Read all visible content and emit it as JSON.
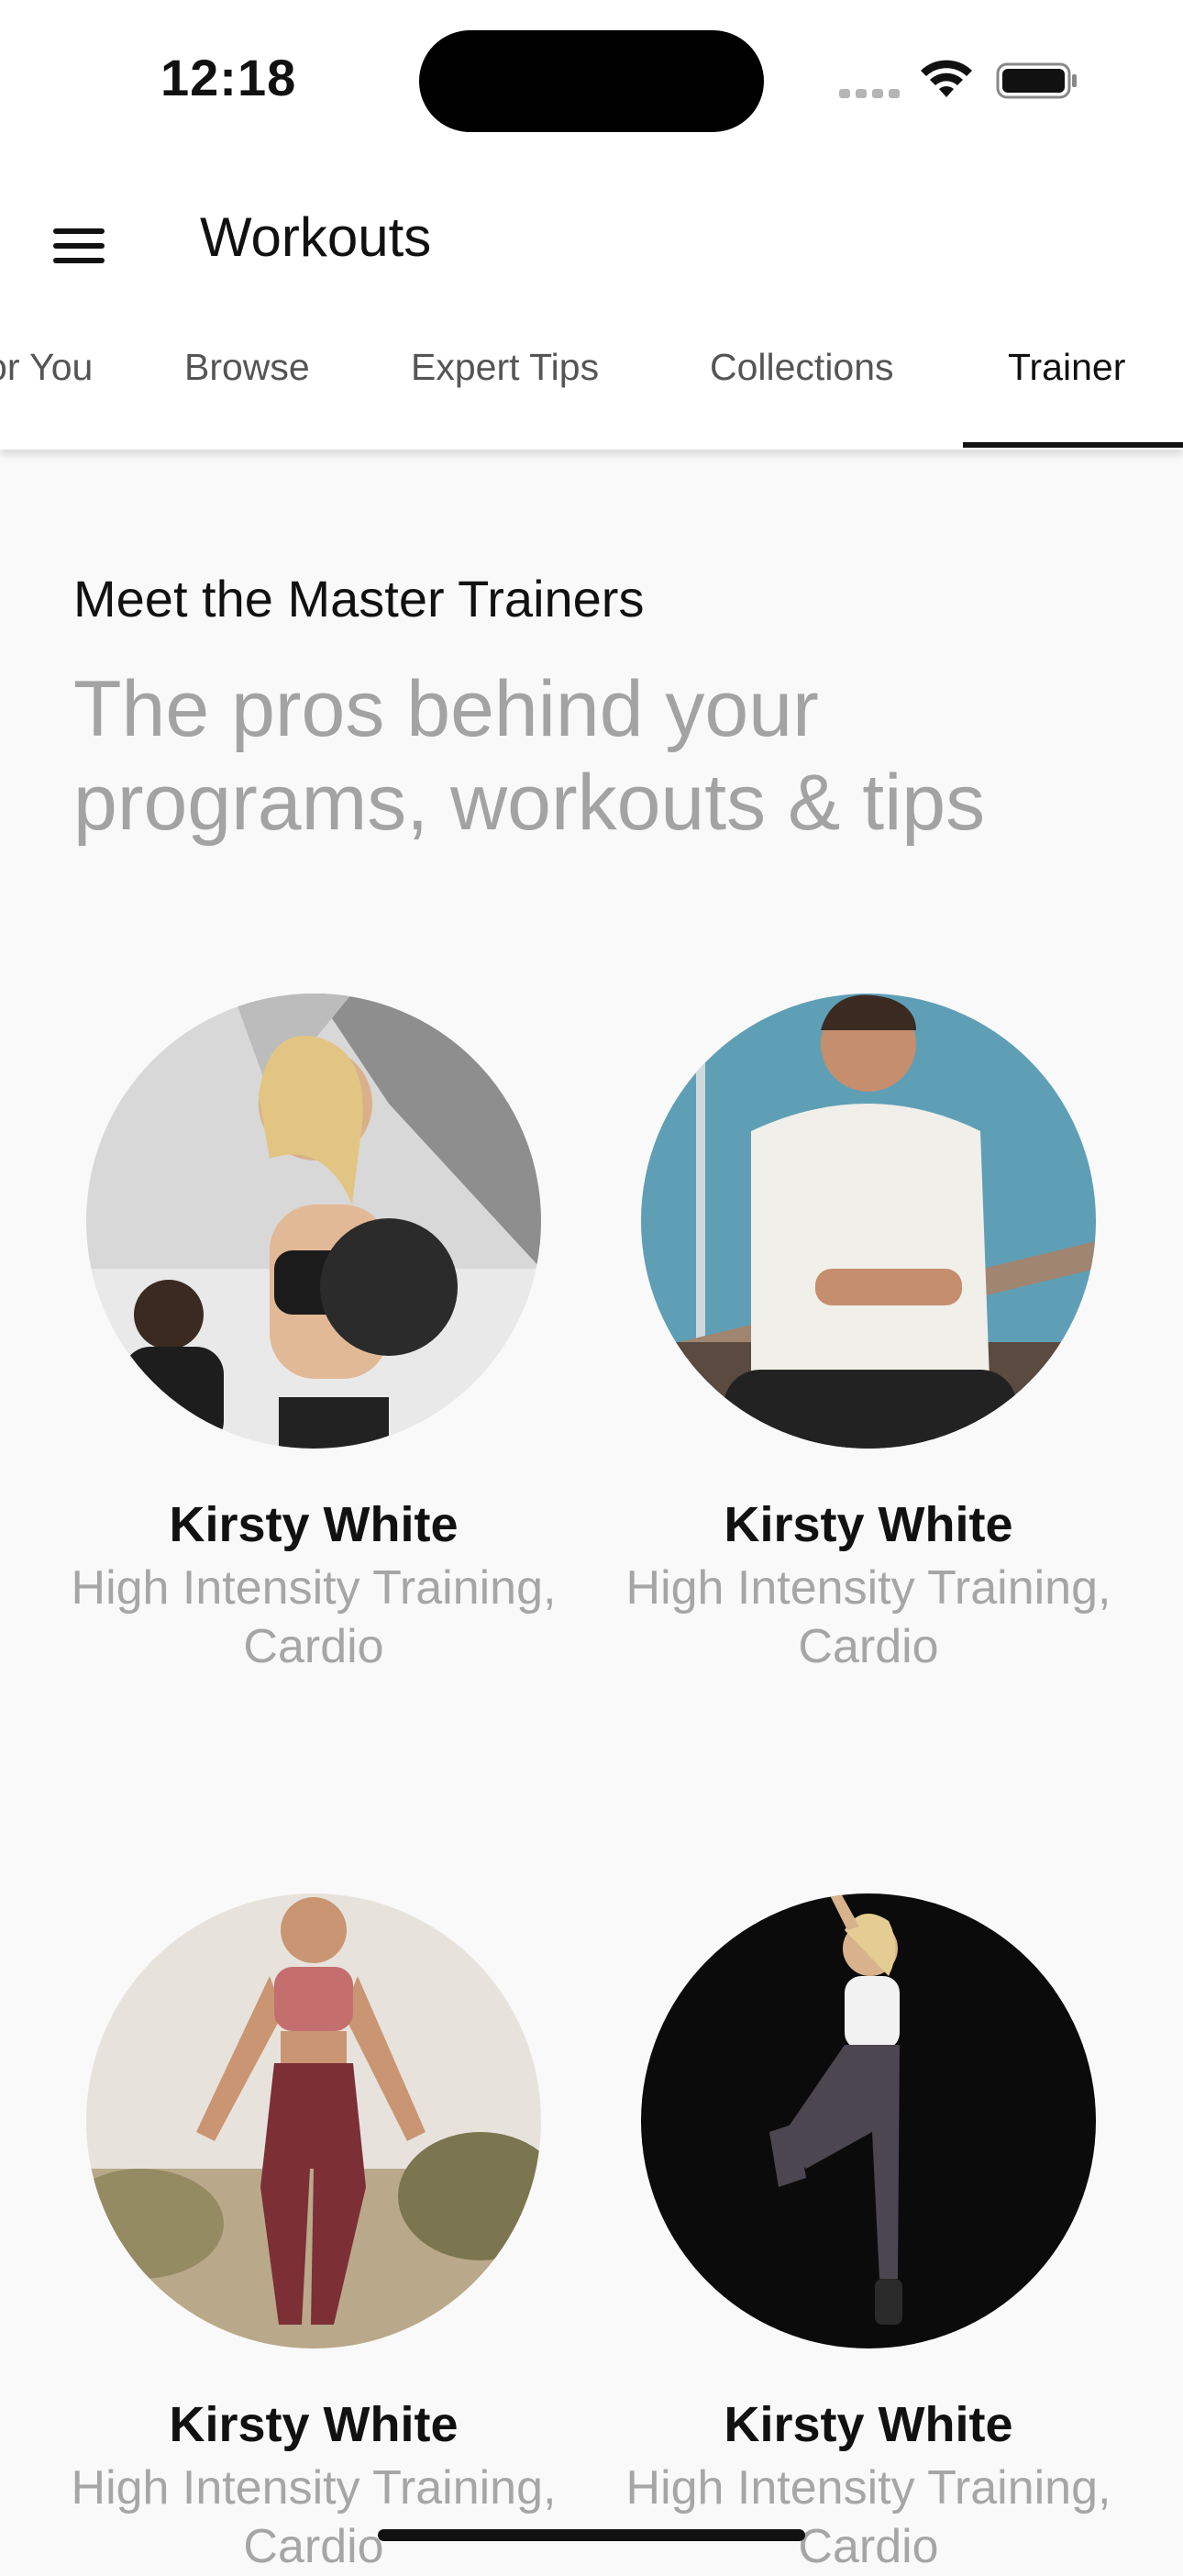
{
  "status": {
    "time": "12:18"
  },
  "appbar": {
    "title": "Workouts"
  },
  "tabs": [
    {
      "label": "For You"
    },
    {
      "label": "Browse"
    },
    {
      "label": "Expert Tips"
    },
    {
      "label": "Collections"
    },
    {
      "label": "Trainer"
    }
  ],
  "page": {
    "heading": "Meet the Master Trainers",
    "subheading": "The pros behind your programs, workouts & tips"
  },
  "trainers": [
    {
      "name": "Kirsty White",
      "specialty": "High Intensity Training, Cardio"
    },
    {
      "name": "Kirsty White",
      "specialty": "High Intensity Training, Cardio"
    },
    {
      "name": "Kirsty White",
      "specialty": "High Intensity Training, Cardio"
    },
    {
      "name": "Kirsty White",
      "specialty": "High Intensity Training, Cardio"
    }
  ],
  "icons": {
    "menu": "hamburger-menu-icon",
    "wifi": "wifi-icon",
    "battery": "battery-icon",
    "signal": "cellular-signal-icon"
  }
}
